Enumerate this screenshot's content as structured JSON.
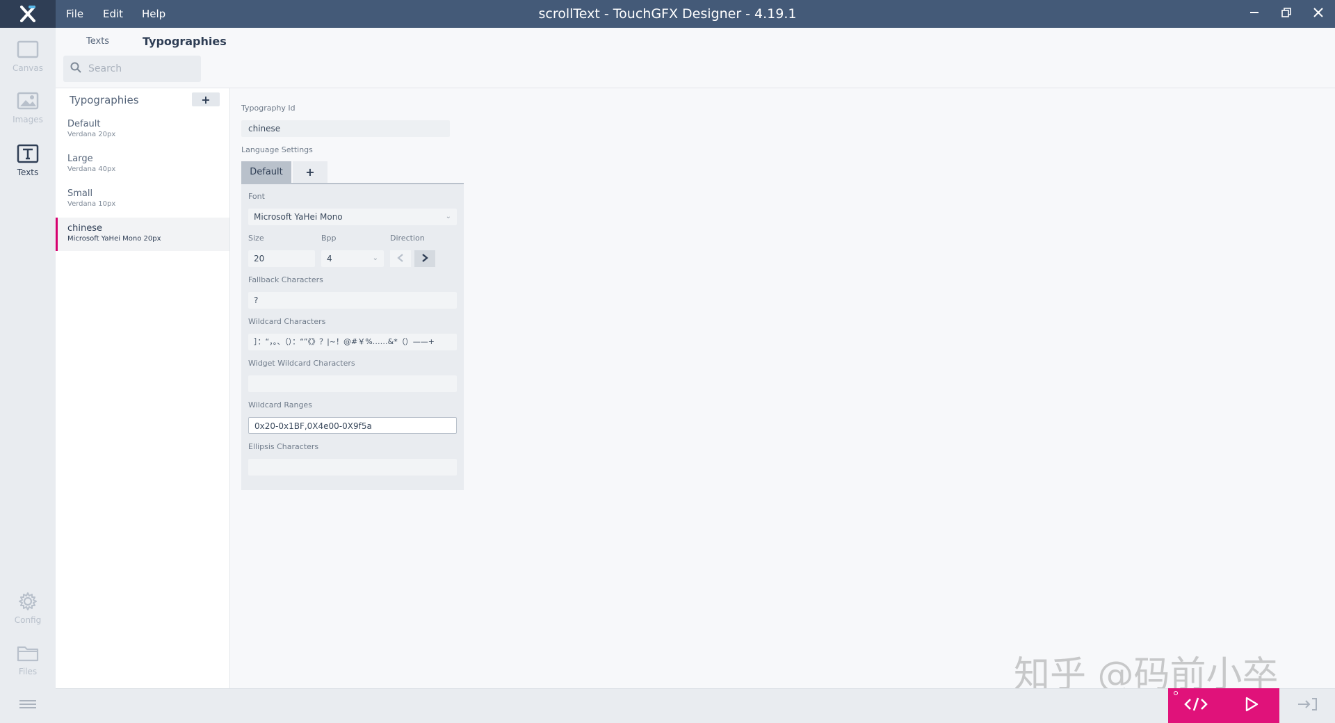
{
  "window": {
    "title": "scrollText - TouchGFX Designer - 4.19.1",
    "menu": [
      "File",
      "Edit",
      "Help"
    ]
  },
  "nav": {
    "canvas": "Canvas",
    "images": "Images",
    "texts": "Texts",
    "config": "Config",
    "files": "Files"
  },
  "header": {
    "tab_texts": "Texts",
    "tab_typographies": "Typographies",
    "search_placeholder": "Search"
  },
  "typographies": {
    "heading": "Typographies",
    "add_symbol": "+",
    "items": [
      {
        "name": "Default",
        "desc": "Verdana  20px"
      },
      {
        "name": "Large",
        "desc": "Verdana  40px"
      },
      {
        "name": "Small",
        "desc": "Verdana  10px"
      },
      {
        "name": "chinese",
        "desc": "Microsoft YaHei Mono  20px"
      }
    ]
  },
  "properties": {
    "typography_id_label": "Typography Id",
    "typography_id": "chinese",
    "language_settings_label": "Language Settings",
    "tab_default": "Default",
    "tab_add": "+",
    "font_label": "Font",
    "font": "Microsoft YaHei Mono",
    "size_label": "Size",
    "size": "20",
    "bpp_label": "Bpp",
    "bpp": "4",
    "direction_label": "Direction",
    "fallback_label": "Fallback Characters",
    "fallback": "?",
    "wildcard_label": "Wildcard Characters",
    "wildcard": "］：“，。、（）：“”《》？|~！@#￥%……&*（）——+",
    "widget_wildcard_label": "Widget Wildcard Characters",
    "widget_wildcard": "",
    "wildcard_ranges_label": "Wildcard Ranges",
    "wildcard_ranges": "0x20-0x1BF,0X4e00-0X9f5a",
    "ellipsis_label": "Ellipsis Characters",
    "ellipsis": ""
  },
  "watermark": "知乎 @码前小卒",
  "colors": {
    "titlebar": "#445a78",
    "accent": "#d6006f",
    "action": "#e0127a"
  }
}
